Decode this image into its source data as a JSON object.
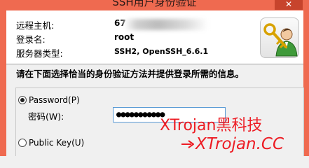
{
  "window": {
    "title": "SSH用户身份验证",
    "close_glyph": "✕"
  },
  "info": {
    "host_label": "远程主机:",
    "host_value": "67",
    "login_label": "登录名:",
    "login_value": "root",
    "server_type_label": "服务器类型:",
    "server_type_value": "SSH2, OpenSSH_6.6.1"
  },
  "instruction": "请在下面选择恰当的身份验证方法并提供登录所需的信息。",
  "auth": {
    "password_option_label": "Password(P)",
    "password_selected": true,
    "password_field_label": "密码(W):",
    "password_value": "●●●●●●●●●●●",
    "publickey_option_label": "Public Key(U)",
    "publickey_selected": false
  },
  "watermark": {
    "line1": "XTrojan黑科技",
    "line2": "XTrojan.CC",
    "color": "#ed1c24"
  },
  "colors": {
    "titlebar": "#ef6a50",
    "close_button": "#c7442d",
    "focus_border": "#5b9bd5"
  },
  "icons": {
    "key_user": "key-user-icon",
    "arrow": "arrow-right-icon"
  }
}
